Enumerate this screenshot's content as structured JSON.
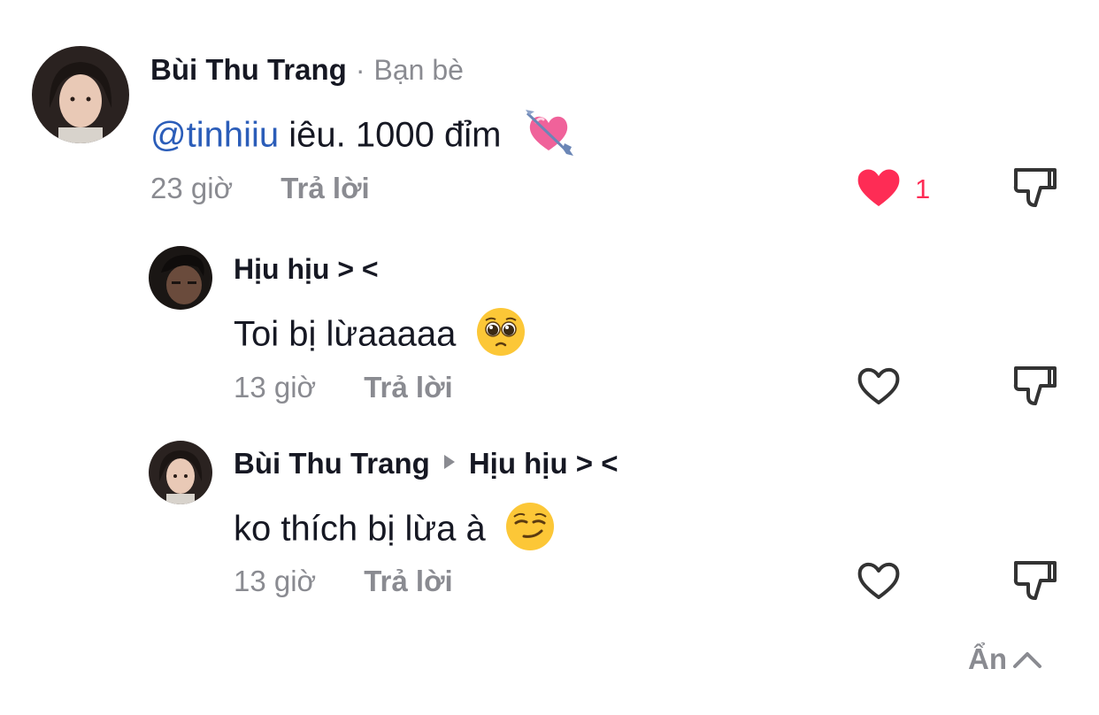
{
  "comment": {
    "author": "Bùi Thu Trang",
    "relation": "Bạn bè",
    "mention": "@tinhiiu",
    "text": " iêu. 1000 đỉm",
    "emoji": "heart-with-arrow",
    "time": "23 giờ",
    "reply_label": "Trả lời",
    "likes": "1",
    "liked": true
  },
  "replies": [
    {
      "author": "Hịu hịu > <",
      "text": "Toi bị lừaaaaa",
      "emoji": "pleading-face",
      "time": "13 giờ",
      "reply_label": "Trả lời",
      "liked": false
    },
    {
      "author": "Bùi Thu Trang",
      "reply_to": "Hịu hịu > <",
      "text": "ko thích bị lừa à",
      "emoji": "smirking-face",
      "time": "13 giờ",
      "reply_label": "Trả lời",
      "liked": false
    }
  ],
  "hide_label": "Ẩn",
  "colors": {
    "like_red": "#fe2c55",
    "mention_blue": "#2b5db9",
    "gray": "#8a8b91"
  }
}
